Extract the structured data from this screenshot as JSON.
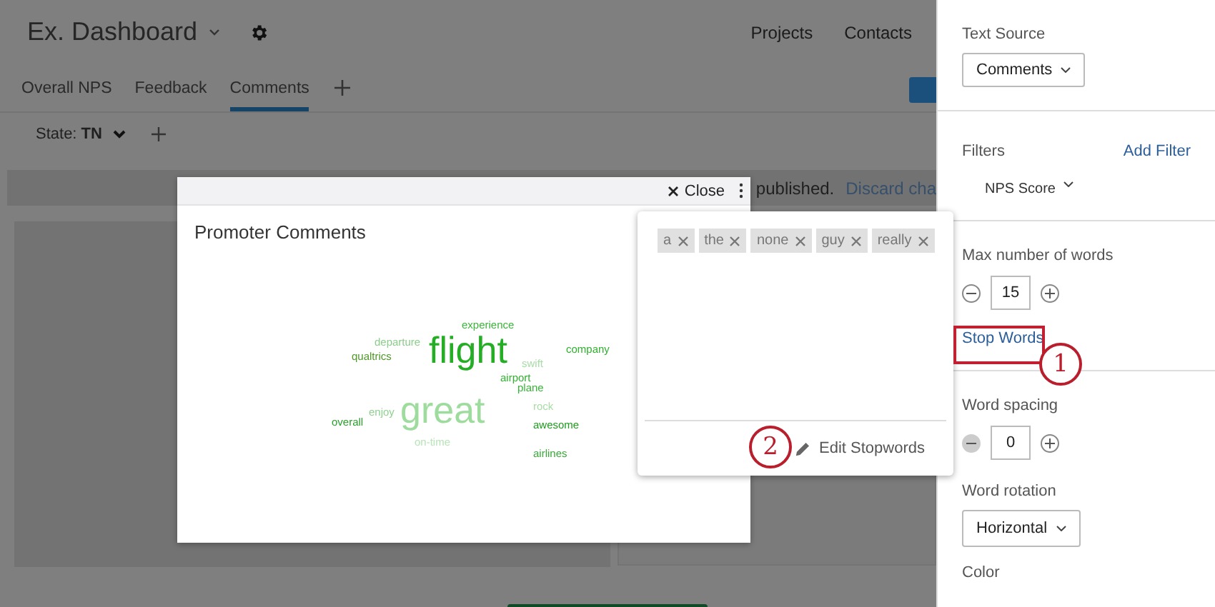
{
  "header": {
    "title": "Ex. Dashboard",
    "nav": [
      "Projects",
      "Contacts"
    ]
  },
  "tabs": [
    {
      "label": "Overall NPS",
      "selected": false
    },
    {
      "label": "Feedback",
      "selected": false
    },
    {
      "label": "Comments",
      "selected": true
    }
  ],
  "filter": {
    "label": "State:",
    "value": "TN"
  },
  "notice": {
    "text": "published.",
    "link": "Discard cha"
  },
  "modal": {
    "close": "Close",
    "title": "Promoter Comments",
    "words": [
      {
        "text": "experience",
        "kind": "small",
        "color": "#3bb43b"
      },
      {
        "text": "departure",
        "kind": "small",
        "color": "#8ccc8c"
      },
      {
        "text": "qualtrics",
        "kind": "small",
        "color": "#4f9a2a"
      },
      {
        "text": "flight",
        "kind": "large",
        "color": "#25ae25"
      },
      {
        "text": "swift",
        "kind": "small",
        "color": "#a8dca8"
      },
      {
        "text": "company",
        "kind": "small",
        "color": "#30b030"
      },
      {
        "text": "airport",
        "kind": "small",
        "color": "#30b030"
      },
      {
        "text": "plane",
        "kind": "small",
        "color": "#38b438"
      },
      {
        "text": "rock",
        "kind": "small",
        "color": "#a8dca8"
      },
      {
        "text": "overall",
        "kind": "small",
        "color": "#2a9e2a"
      },
      {
        "text": "enjoy",
        "kind": "small",
        "color": "#8fd08f"
      },
      {
        "text": "great",
        "kind": "large",
        "color": "#9edc9e"
      },
      {
        "text": "awesome",
        "kind": "small",
        "color": "#1e9a1e"
      },
      {
        "text": "on-time",
        "kind": "small",
        "color": "#b8e4b8"
      },
      {
        "text": "airlines",
        "kind": "small",
        "color": "#3aa83a"
      }
    ]
  },
  "stopwords": {
    "tags": [
      "a",
      "the",
      "none",
      "guy",
      "really"
    ],
    "edit": "Edit Stopwords"
  },
  "panel": {
    "text_source": {
      "label": "Text Source",
      "value": "Comments"
    },
    "filters": {
      "label": "Filters",
      "add": "Add Filter",
      "items": [
        "NPS Score"
      ]
    },
    "max_words": {
      "label": "Max number of words",
      "value": "15",
      "minus_disabled": false
    },
    "stop_words": "Stop Words",
    "spacing": {
      "label": "Word spacing",
      "value": "0",
      "minus_disabled": true
    },
    "rotation": {
      "label": "Word rotation",
      "value": "Horizontal"
    },
    "color_label": "Color"
  },
  "callouts": [
    "1",
    "2"
  ]
}
